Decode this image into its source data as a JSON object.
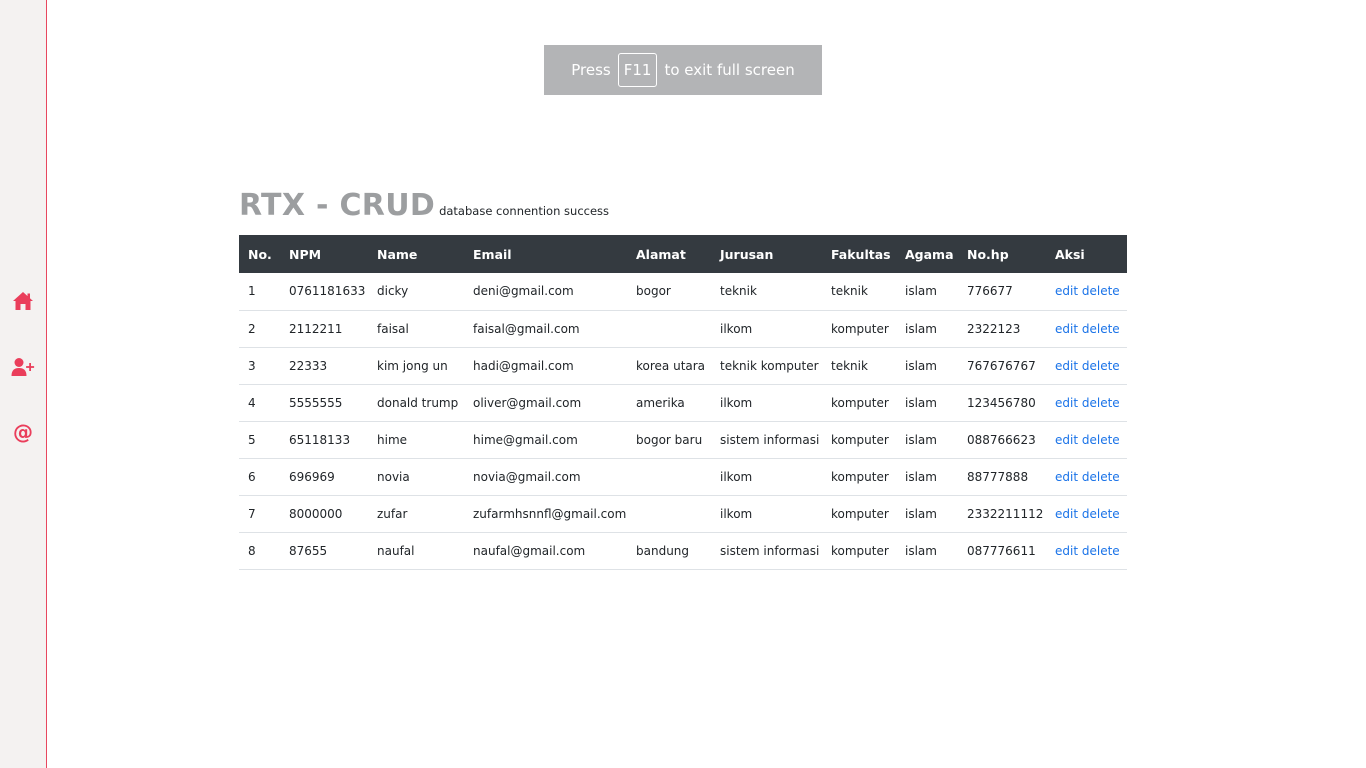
{
  "sidebar": {
    "icons": [
      {
        "name": "home-icon",
        "color": "#ea3e5b"
      },
      {
        "name": "add-user-icon",
        "color": "#ea3e5b"
      },
      {
        "name": "at-icon",
        "glyph": "@",
        "color": "#ea3e5b"
      }
    ],
    "accent": "#e8475f"
  },
  "fullscreen_toast": {
    "press": "Press",
    "key": "F11",
    "rest": "to exit full screen"
  },
  "heading": {
    "title": "RTX - CRUD",
    "subtitle": "database connention success"
  },
  "table": {
    "columns": [
      "No.",
      "NPM",
      "Name",
      "Email",
      "Alamat",
      "Jurusan",
      "Fakultas",
      "Agama",
      "No.hp",
      "Aksi"
    ],
    "rows": [
      {
        "no": "1",
        "npm": "0761181633",
        "name": "dicky",
        "email": "deni@gmail.com",
        "alamat": "bogor",
        "jurusan": "teknik",
        "fakultas": "teknik",
        "agama": "islam",
        "nohp": "776677",
        "edit": "edit",
        "delete": "delete"
      },
      {
        "no": "2",
        "npm": "2112211",
        "name": "faisal",
        "email": "faisal@gmail.com",
        "alamat": "",
        "jurusan": "ilkom",
        "fakultas": "komputer",
        "agama": "islam",
        "nohp": "2322123",
        "edit": "edit",
        "delete": "delete"
      },
      {
        "no": "3",
        "npm": "22333",
        "name": "kim jong un",
        "email": "hadi@gmail.com",
        "alamat": "korea utara",
        "jurusan": "teknik komputer",
        "fakultas": "teknik",
        "agama": "islam",
        "nohp": "767676767",
        "edit": "edit",
        "delete": "delete"
      },
      {
        "no": "4",
        "npm": "5555555",
        "name": "donald trump",
        "email": "oliver@gmail.com",
        "alamat": "amerika",
        "jurusan": "ilkom",
        "fakultas": "komputer",
        "agama": "islam",
        "nohp": "123456780",
        "edit": "edit",
        "delete": "delete"
      },
      {
        "no": "5",
        "npm": "65118133",
        "name": "hime",
        "email": "hime@gmail.com",
        "alamat": "bogor baru",
        "jurusan": "sistem informasi",
        "fakultas": "komputer",
        "agama": "islam",
        "nohp": "088766623",
        "edit": "edit",
        "delete": "delete"
      },
      {
        "no": "6",
        "npm": "696969",
        "name": "novia",
        "email": "novia@gmail.com",
        "alamat": "",
        "jurusan": "ilkom",
        "fakultas": "komputer",
        "agama": "islam",
        "nohp": "88777888",
        "edit": "edit",
        "delete": "delete"
      },
      {
        "no": "7",
        "npm": "8000000",
        "name": "zufar",
        "email": "zufarmhsnnfl@gmail.com",
        "alamat": "",
        "jurusan": "ilkom",
        "fakultas": "komputer",
        "agama": "islam",
        "nohp": "2332211112",
        "edit": "edit",
        "delete": "delete"
      },
      {
        "no": "8",
        "npm": "87655",
        "name": "naufal",
        "email": "naufal@gmail.com",
        "alamat": "bandung",
        "jurusan": "sistem informasi",
        "fakultas": "komputer",
        "agama": "islam",
        "nohp": "087776611",
        "edit": "edit",
        "delete": "delete"
      }
    ]
  }
}
